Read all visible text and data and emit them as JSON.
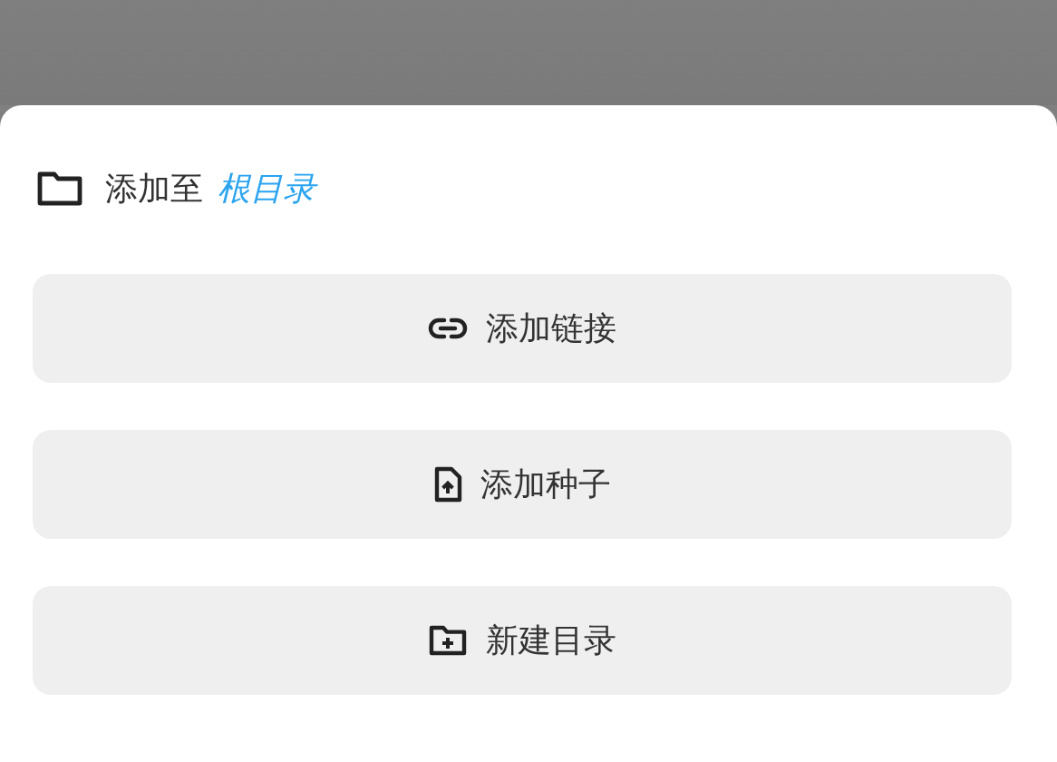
{
  "header": {
    "label": "添加至",
    "target": "根目录"
  },
  "actions": [
    {
      "kind": "link",
      "label": "添加链接"
    },
    {
      "kind": "torrent",
      "label": "添加种子"
    },
    {
      "kind": "folder",
      "label": "新建目录"
    }
  ]
}
